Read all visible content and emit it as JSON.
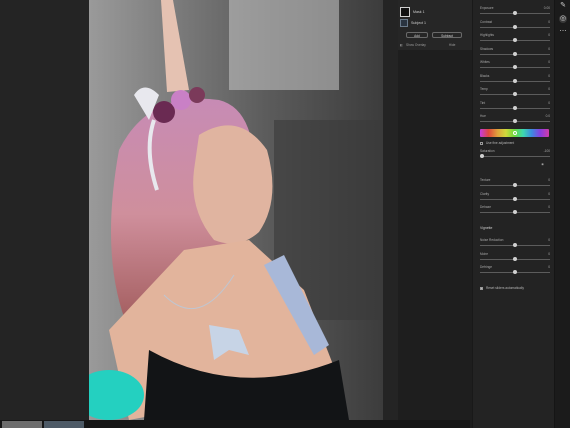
{
  "masks": {
    "items": [
      {
        "label": "Mask 1",
        "icon": "mask-thumbnail-icon"
      },
      {
        "label": "Subject 1",
        "icon": "person-icon"
      }
    ],
    "add_label": "Add",
    "subtract_label": "Subtract",
    "show_overlay_label": "Show Overlay",
    "hide_label": "Hide"
  },
  "panel": {
    "sliders": [
      {
        "label": "Exposure",
        "value": "0.00",
        "pos": 0.5
      },
      {
        "label": "Contrast",
        "value": "0",
        "pos": 0.5
      },
      {
        "label": "Highlights",
        "value": "0",
        "pos": 0.5
      },
      {
        "label": "Shadows",
        "value": "0",
        "pos": 0.5
      },
      {
        "label": "Whites",
        "value": "0",
        "pos": 0.5
      },
      {
        "label": "Blacks",
        "value": "0",
        "pos": 0.5
      },
      {
        "label": "Temp",
        "value": "0",
        "pos": 0.5
      },
      {
        "label": "Tint",
        "value": "0",
        "pos": 0.5
      },
      {
        "label": "Hue",
        "value": "0.0",
        "pos": 0.5
      }
    ],
    "fine_adjust_label": "Use fine adjustment",
    "saturation": {
      "label": "Saturation",
      "value": "-100",
      "pos": 0.0
    },
    "detail_sliders": [
      {
        "label": "Texture",
        "value": "0",
        "pos": 0.5
      },
      {
        "label": "Clarity",
        "value": "0",
        "pos": 0.5
      },
      {
        "label": "Dehaze",
        "value": "0",
        "pos": 0.5
      }
    ],
    "effects_label": "Vignette",
    "effects_sliders": [
      {
        "label": "Noise Reduction",
        "value": "0",
        "pos": 0.5
      },
      {
        "label": "Moire",
        "value": "0",
        "pos": 0.5
      },
      {
        "label": "Defringe",
        "value": "0",
        "pos": 0.5
      }
    ],
    "reset_label": "Reset sliders automatically"
  }
}
